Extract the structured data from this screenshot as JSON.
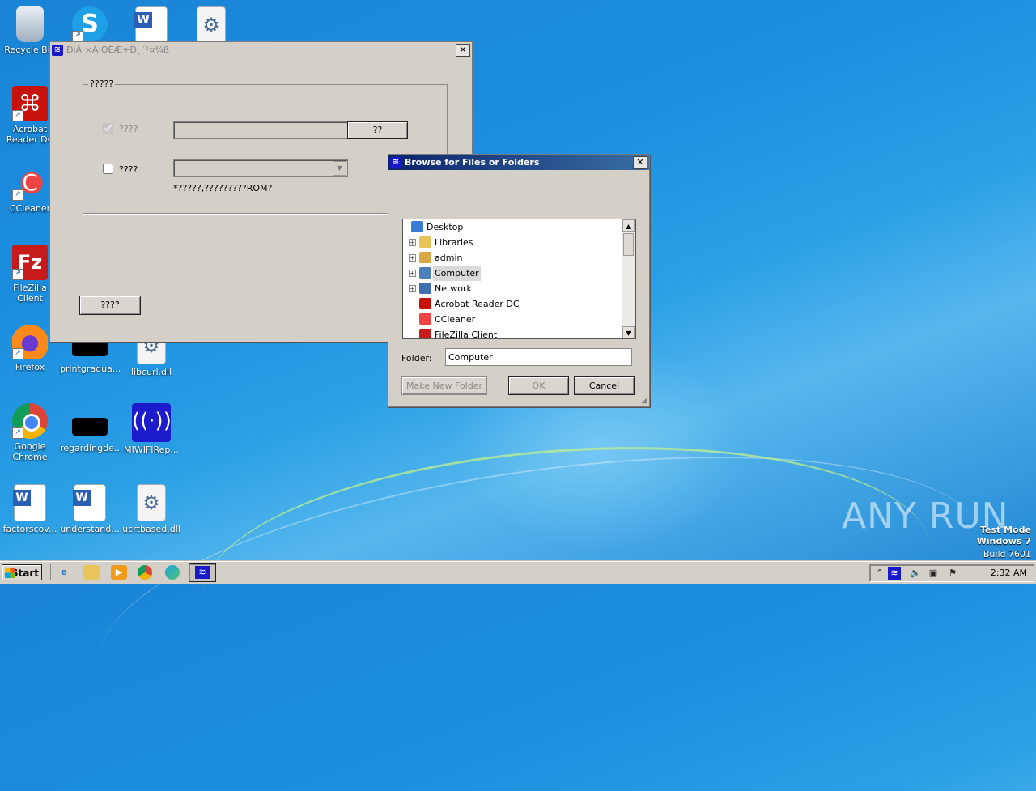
{
  "desktop": {
    "icons": [
      {
        "label": "Recycle Bin",
        "icon": "recycle-bin-icon"
      },
      {
        "label": "Acrobat Reader DC",
        "icon": "acrobat-icon"
      },
      {
        "label": "CCleaner",
        "icon": "ccleaner-icon"
      },
      {
        "label": "FileZilla Client",
        "icon": "filezilla-icon"
      },
      {
        "label": "Firefox",
        "icon": "firefox-icon"
      },
      {
        "label": "Google Chrome",
        "icon": "chrome-icon"
      },
      {
        "label": "factorscov...",
        "icon": "word-doc-icon"
      },
      {
        "label": "printgradua...",
        "icon": "black-file-icon"
      },
      {
        "label": "regardingde...",
        "icon": "black-file-icon"
      },
      {
        "label": "understand...",
        "icon": "word-doc-icon"
      },
      {
        "label": "libcurl.dll",
        "icon": "dll-gear-icon"
      },
      {
        "label": "MIWIFIRep...",
        "icon": "wifi-app-icon"
      },
      {
        "label": "ucrtbased.dll",
        "icon": "dll-gear-icon"
      }
    ],
    "watermark": "ANY RUN",
    "test_mode": {
      "line1": "Test Mode",
      "line2": "Windows 7",
      "line3": "Build 7601"
    }
  },
  "app_window": {
    "title": "ÐiÂ ×Â·ÓÉÆ÷Ðͺ´¹¤¾ß",
    "group_label": "?????",
    "option1_label": "????",
    "option1_checked": true,
    "option1_button": "??",
    "option2_label": "????",
    "option2_checked": false,
    "hint": "*?????,?????????ROM?",
    "bottom_button": "????"
  },
  "browse_dialog": {
    "title": "Browse for Files or Folders",
    "tree": [
      {
        "label": "Desktop",
        "icon": "desktop-icon",
        "expandable": false,
        "level": 0,
        "selected": false
      },
      {
        "label": "Libraries",
        "icon": "libraries-icon",
        "expandable": true,
        "level": 1,
        "selected": false
      },
      {
        "label": "admin",
        "icon": "user-folder-icon",
        "expandable": true,
        "level": 1,
        "selected": false
      },
      {
        "label": "Computer",
        "icon": "computer-icon",
        "expandable": true,
        "level": 1,
        "selected": true
      },
      {
        "label": "Network",
        "icon": "network-icon",
        "expandable": true,
        "level": 1,
        "selected": false
      },
      {
        "label": "Acrobat Reader DC",
        "icon": "acrobat-icon",
        "expandable": false,
        "level": 1,
        "selected": false
      },
      {
        "label": "CCleaner",
        "icon": "ccleaner-icon",
        "expandable": false,
        "level": 1,
        "selected": false
      },
      {
        "label": "FileZilla Client",
        "icon": "filezilla-icon",
        "expandable": false,
        "level": 1,
        "selected": false
      }
    ],
    "folder_label": "Folder:",
    "folder_value": "Computer",
    "make_new_folder": "Make New Folder",
    "ok": "OK",
    "cancel": "Cancel"
  },
  "taskbar": {
    "start_label": "Start",
    "clock": "2:32 AM"
  }
}
